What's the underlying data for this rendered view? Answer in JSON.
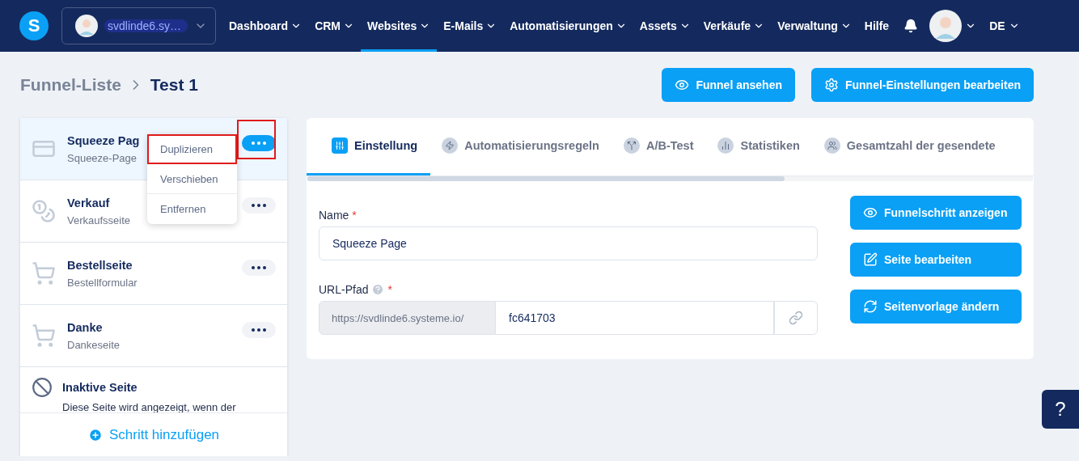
{
  "header": {
    "logo": "S",
    "account": {
      "name": "svdlinde6.sy…"
    },
    "nav": [
      {
        "label": "Dashboard",
        "selected": false,
        "dropdown": true
      },
      {
        "label": "CRM",
        "selected": false,
        "dropdown": true
      },
      {
        "label": "Websites",
        "selected": true,
        "dropdown": true
      },
      {
        "label": "E-Mails",
        "selected": false,
        "dropdown": true
      },
      {
        "label": "Automatisierungen",
        "selected": false,
        "dropdown": true
      },
      {
        "label": "Assets",
        "selected": false,
        "dropdown": true
      },
      {
        "label": "Verkäufe",
        "selected": false,
        "dropdown": true
      },
      {
        "label": "Verwaltung",
        "selected": false,
        "dropdown": true
      },
      {
        "label": "Hilfe",
        "selected": false,
        "dropdown": false
      }
    ],
    "language": "DE"
  },
  "breadcrumb": {
    "parent": "Funnel-Liste",
    "current": "Test 1"
  },
  "actions": [
    {
      "label": "Funnel ansehen"
    },
    {
      "label": "Funnel-Einstellungen bearbeiten"
    }
  ],
  "steps": [
    {
      "kind": "squeeze",
      "title": "Squeeze Pag",
      "subtitle": "Squeeze-Page",
      "selected": true,
      "highlighted": true
    },
    {
      "kind": "sales",
      "title": "Verkauf",
      "subtitle": "Verkaufsseite",
      "selected": false,
      "highlighted": false
    },
    {
      "kind": "order",
      "title": "Bestellseite",
      "subtitle": "Bestellformular",
      "selected": false,
      "highlighted": false
    },
    {
      "kind": "thanks",
      "title": "Danke",
      "subtitle": "Dankeseite",
      "selected": false,
      "highlighted": false
    }
  ],
  "inactive": {
    "title": "Inaktive Seite",
    "description": "Diese Seite wird angezeigt, wenn der"
  },
  "step_menu": {
    "items": [
      {
        "label": "Duplizieren",
        "highlighted": true
      },
      {
        "label": "Verschieben",
        "highlighted": false
      },
      {
        "label": "Entfernen",
        "highlighted": false
      }
    ]
  },
  "add_step": "Schritt hinzufügen",
  "tabs": [
    {
      "label": "Einstellung",
      "selected": true
    },
    {
      "label": "Automatisierungsregeln",
      "selected": false
    },
    {
      "label": "A/B-Test",
      "selected": false
    },
    {
      "label": "Statistiken",
      "selected": false
    },
    {
      "label": "Gesamtzahl der gesendete",
      "selected": false
    }
  ],
  "form": {
    "name": {
      "label": "Name",
      "required_mark": "*",
      "value": "Squeeze Page"
    },
    "url": {
      "label": "URL-Pfad",
      "required_mark": "*",
      "prefix": "https://svdlinde6.systeme.io/",
      "value": "fc641703"
    }
  },
  "page_actions": [
    {
      "label": "Funnelschritt anzeigen"
    },
    {
      "label": "Seite bearbeiten"
    },
    {
      "label": "Seitenvorlage ändern"
    }
  ],
  "help": "?"
}
